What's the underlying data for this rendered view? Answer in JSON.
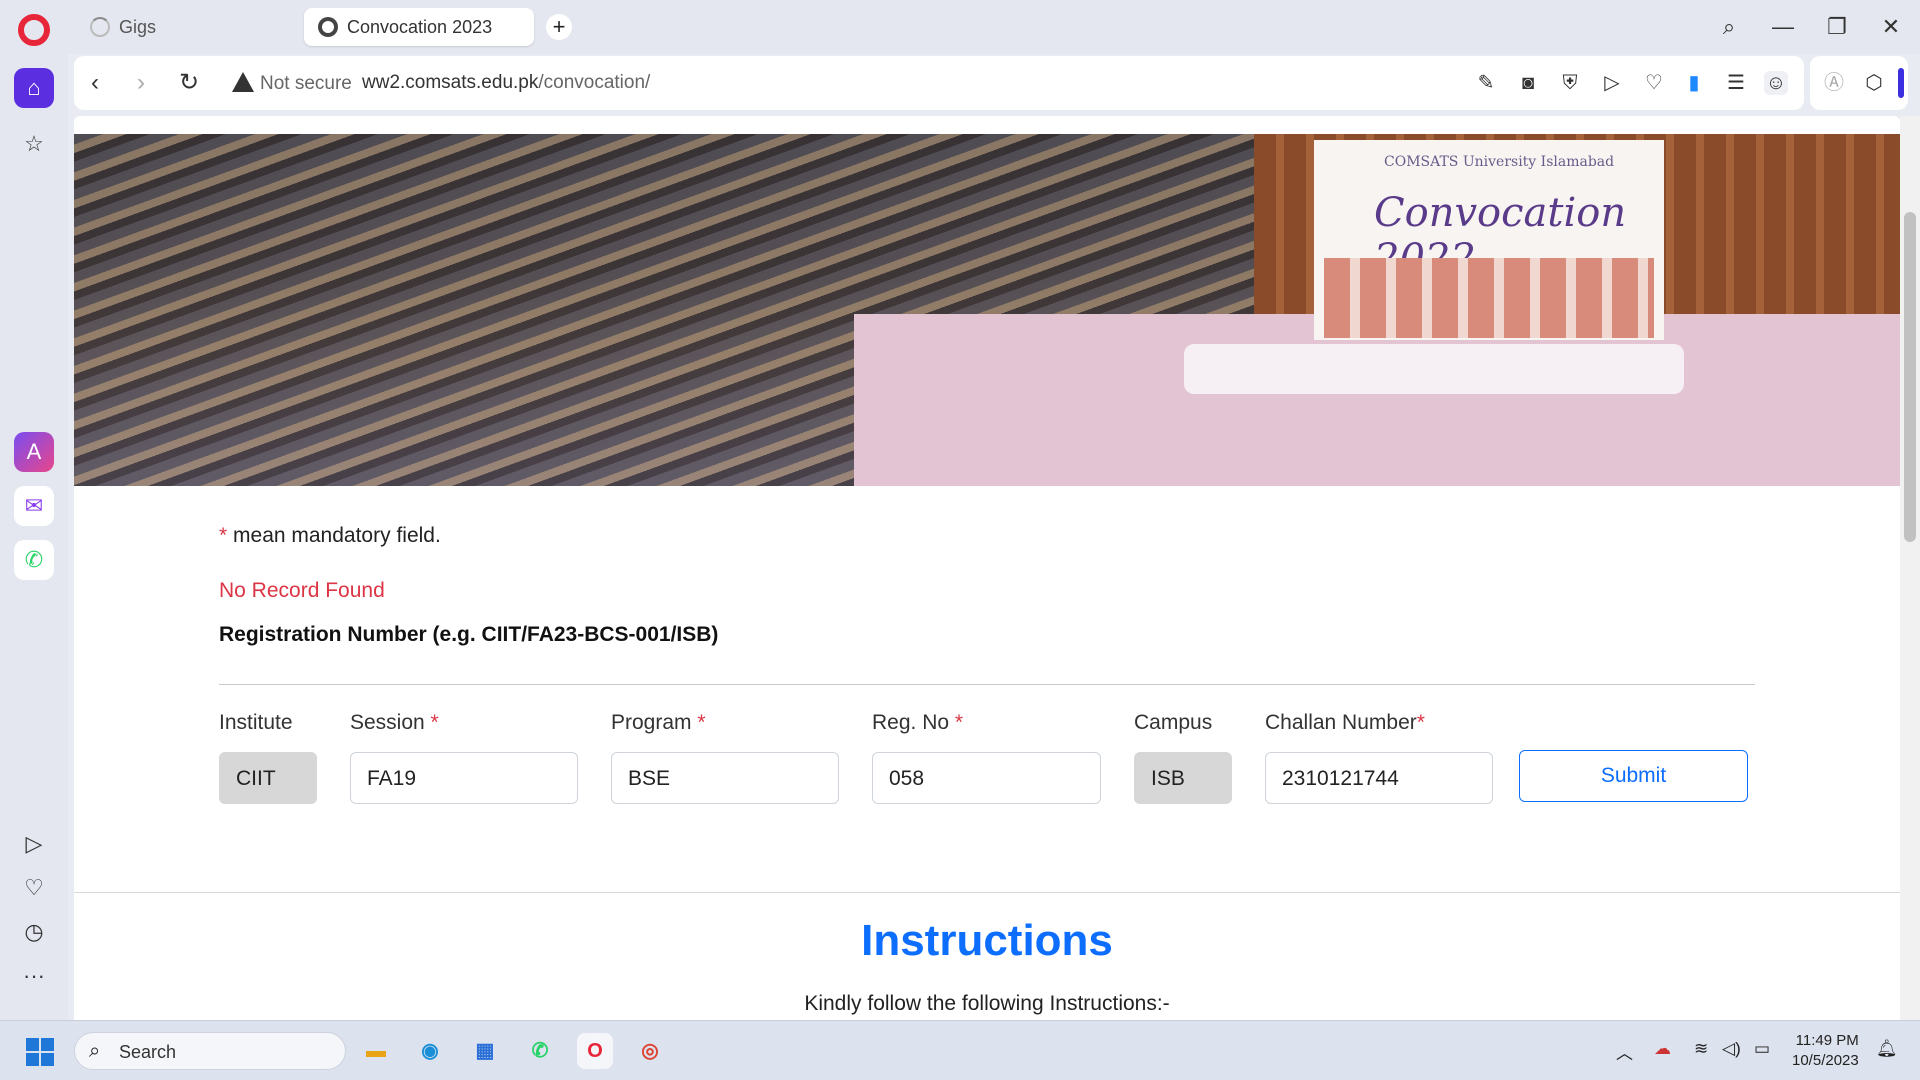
{
  "browser": {
    "tabs": [
      {
        "label": "Gigs"
      },
      {
        "label": "Convocation 2023"
      }
    ],
    "new_tab": "+",
    "nav": {
      "back": "‹",
      "forward": "›",
      "reload": "↻"
    },
    "security_label": "Not secure",
    "url_host": "ww2.comsats.edu.pk",
    "url_path": "/convocation/",
    "window_controls": {
      "search": "⌕",
      "minimize": "—",
      "restore": "❐",
      "close": "✕"
    }
  },
  "banner": {
    "panel_subtitle": "COMSATS University Islamabad",
    "panel_title": "Convocation 2022"
  },
  "form": {
    "mandatory_star": "*",
    "mandatory_note": " mean mandatory field.",
    "message": "No Record Found",
    "registration_label": "Registration Number (e.g. CIIT/FA23-BCS-001/ISB)",
    "fields": [
      {
        "label": "Institute",
        "required": "",
        "value": "CIIT"
      },
      {
        "label": "Session",
        "required": " *",
        "value": "FA19"
      },
      {
        "label": "Program",
        "required": " *",
        "value": "BSE"
      },
      {
        "label": "Reg. No",
        "required": " *",
        "value": "058"
      },
      {
        "label": "Campus",
        "required": "",
        "value": "ISB"
      },
      {
        "label": "Challan Number",
        "required": "*",
        "value": "2310121744"
      }
    ],
    "submit_label": "Submit"
  },
  "instructions": {
    "title": "Instructions",
    "subtitle": "Kindly follow the following Instructions:-"
  },
  "taskbar": {
    "search_label": "Search",
    "time": "11:49 PM",
    "date": "10/5/2023"
  },
  "colors": {
    "accent": "#0d6efd",
    "error": "#dc3545",
    "opera_red": "#e8263a",
    "sidebar_active": "#5b2fe0"
  }
}
